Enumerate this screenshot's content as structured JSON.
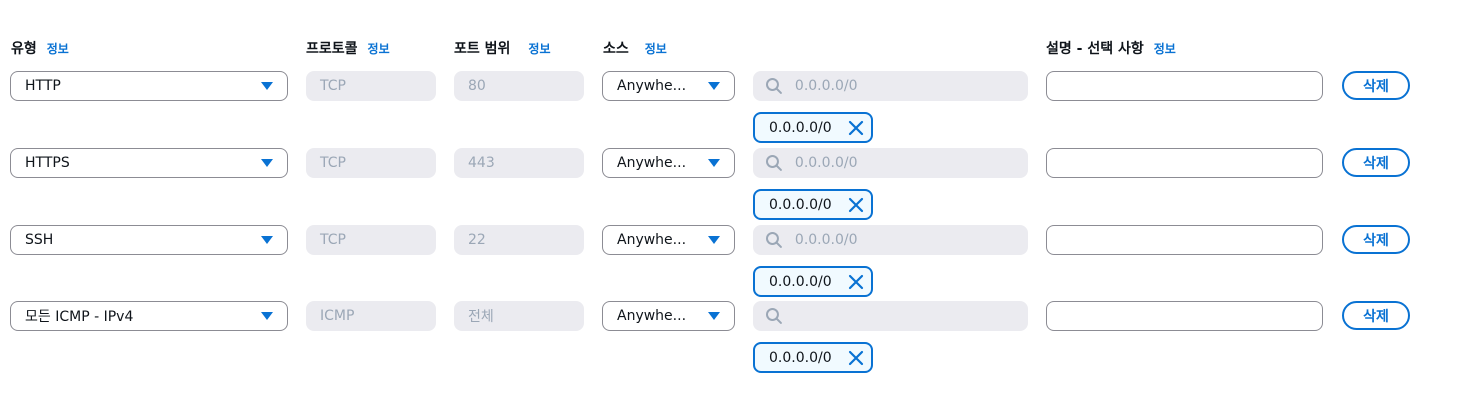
{
  "headers": {
    "type": "유형",
    "protocol": "프로토콜",
    "port_range": "포트 범위",
    "source": "소스",
    "description": "설명 - 선택 사항",
    "info": "정보"
  },
  "colors": {
    "accent": "#0972d3",
    "disabled_bg": "#ebebf0",
    "disabled_text": "#9ba7b6",
    "border": "#8c8c94",
    "token_bg": "#f1faff"
  },
  "icons": {
    "dropdown": "caret-down-icon",
    "search": "search-icon",
    "remove": "close-icon"
  },
  "rows": [
    {
      "type": "HTTP",
      "protocol": "TCP",
      "port": "80",
      "source": "Anywhe...",
      "search_placeholder": "0.0.0.0/0",
      "description": "",
      "token": "0.0.0.0/0",
      "delete": "삭제"
    },
    {
      "type": "HTTPS",
      "protocol": "TCP",
      "port": "443",
      "source": "Anywhe...",
      "search_placeholder": "0.0.0.0/0",
      "description": "",
      "token": "0.0.0.0/0",
      "delete": "삭제"
    },
    {
      "type": "SSH",
      "protocol": "TCP",
      "port": "22",
      "source": "Anywhe...",
      "search_placeholder": "0.0.0.0/0",
      "description": "",
      "token": "0.0.0.0/0",
      "delete": "삭제"
    },
    {
      "type": "모든 ICMP - IPv4",
      "protocol": "ICMP",
      "port": "전체",
      "source": "Anywhe...",
      "search_placeholder": "",
      "description": "",
      "token": "0.0.0.0/0",
      "delete": "삭제"
    }
  ]
}
